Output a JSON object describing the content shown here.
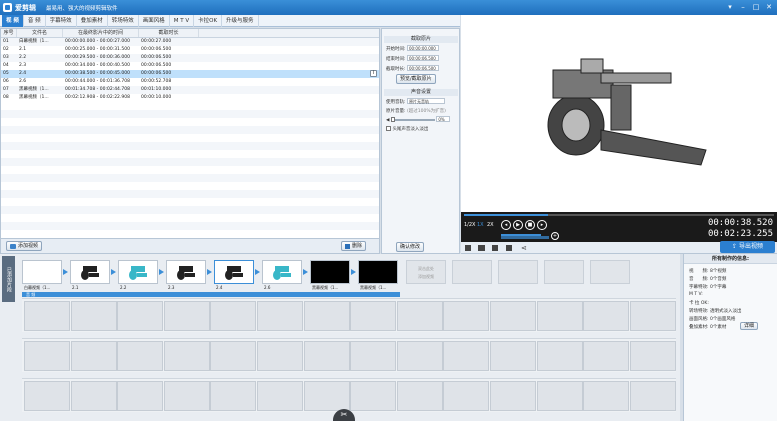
{
  "app": {
    "name": "爱剪辑",
    "slogan": "最易用、强大的视频剪辑软件"
  },
  "menu": {
    "tabs": [
      "视 频",
      "音 频",
      "字幕特效",
      "叠加素材",
      "转场特效",
      "画面风格",
      "M T V",
      "卡拉OK",
      "升级与服务"
    ],
    "active_index": 0
  },
  "clip_list": {
    "columns": [
      "序号",
      "文件名",
      "在最终影片中的时间",
      "截取时长"
    ],
    "rows": [
      {
        "no": "01",
        "name": "白幕视频（1...",
        "time": "00:00:00.000 - 00:00:27.000",
        "dur": "00:00:27.000"
      },
      {
        "no": "02",
        "name": "2.1",
        "time": "00:00:25.000 - 00:00:31.500",
        "dur": "00:00:06.500"
      },
      {
        "no": "03",
        "name": "2.2",
        "time": "00:00:29.500 - 00:00:36.000",
        "dur": "00:00:06.500"
      },
      {
        "no": "04",
        "name": "2.3",
        "time": "00:00:34.000 - 00:00:40.500",
        "dur": "00:00:06.500"
      },
      {
        "no": "05",
        "name": "2.4",
        "time": "00:00:38.500 - 00:00:45.000",
        "dur": "00:00:06.500"
      },
      {
        "no": "06",
        "name": "2.6",
        "time": "00:00:44.000 - 00:01:36.708",
        "dur": "00:00:52.708"
      },
      {
        "no": "07",
        "name": "黑幕视频（1...",
        "time": "00:01:34.708 - 00:02:44.708",
        "dur": "00:01:10.000"
      },
      {
        "no": "08",
        "name": "黑幕视频（1...",
        "time": "00:02:12.908 - 00:02:22.908",
        "dur": "00:00:10.000"
      }
    ],
    "selected_index": 4,
    "info_icon": "info-icon",
    "add_video_label": "添加视频",
    "delete_label": "删除",
    "confirm_label": "确认修改"
  },
  "props": {
    "trim_header": "截取原片",
    "start_label": "开始时间:",
    "start_value": "00:00:00.000",
    "end_label": "结束时间:",
    "end_value": "00:00:06.500",
    "dur_label": "截取时长:",
    "dur_value": "00:00:06.500",
    "trim_btn": "预览/截取原片",
    "audio_header": "声音设置",
    "track_label": "使用音轨:",
    "track_value": "原片无音轨",
    "volume_label": "原片音量:",
    "volume_hint": "(超过100%为扩音)",
    "volume_value": "0%",
    "fade_label": "头尾声音淡入淡出"
  },
  "player": {
    "speeds": [
      "1/2X",
      "1X",
      "2X"
    ],
    "current_time": "00:00:38.520",
    "total_time": "00:02:23.255",
    "export_label": "导出视频"
  },
  "timeline": {
    "side_label": "已添加片段",
    "clips": [
      {
        "label": "白幕视频（1...",
        "style": "white"
      },
      {
        "label": "2.1",
        "style": "robot"
      },
      {
        "label": "2.2",
        "style": "robot-cyan"
      },
      {
        "label": "2.3",
        "style": "robot"
      },
      {
        "label": "2.4",
        "style": "robot-selected"
      },
      {
        "label": "2.6",
        "style": "robot-cyan"
      },
      {
        "label": "黑幕视频（1...",
        "style": "black"
      },
      {
        "label": "黑幕视频（1...",
        "style": "black"
      }
    ],
    "add_hint_line1": "双击此处",
    "add_hint_line2": "添加视频",
    "audio_track_label": "音 频"
  },
  "info_panel": {
    "title": "所有制作的信息:",
    "rows": [
      {
        "label": "视　　频:",
        "value": "8个视频"
      },
      {
        "label": "音　　频:",
        "value": "0个音频"
      },
      {
        "label": "字幕特效:",
        "value": "0个字幕"
      },
      {
        "label": "M T V:",
        "value": ""
      },
      {
        "label": "卡 拉 OK:",
        "value": ""
      },
      {
        "label": "转场特效:",
        "value": "透明式淡入淡出"
      },
      {
        "label": "画面风格:",
        "value": "0个画面风格"
      },
      {
        "label": "叠加素材:",
        "value": "0个素材"
      }
    ],
    "detail_btn": "详细"
  }
}
